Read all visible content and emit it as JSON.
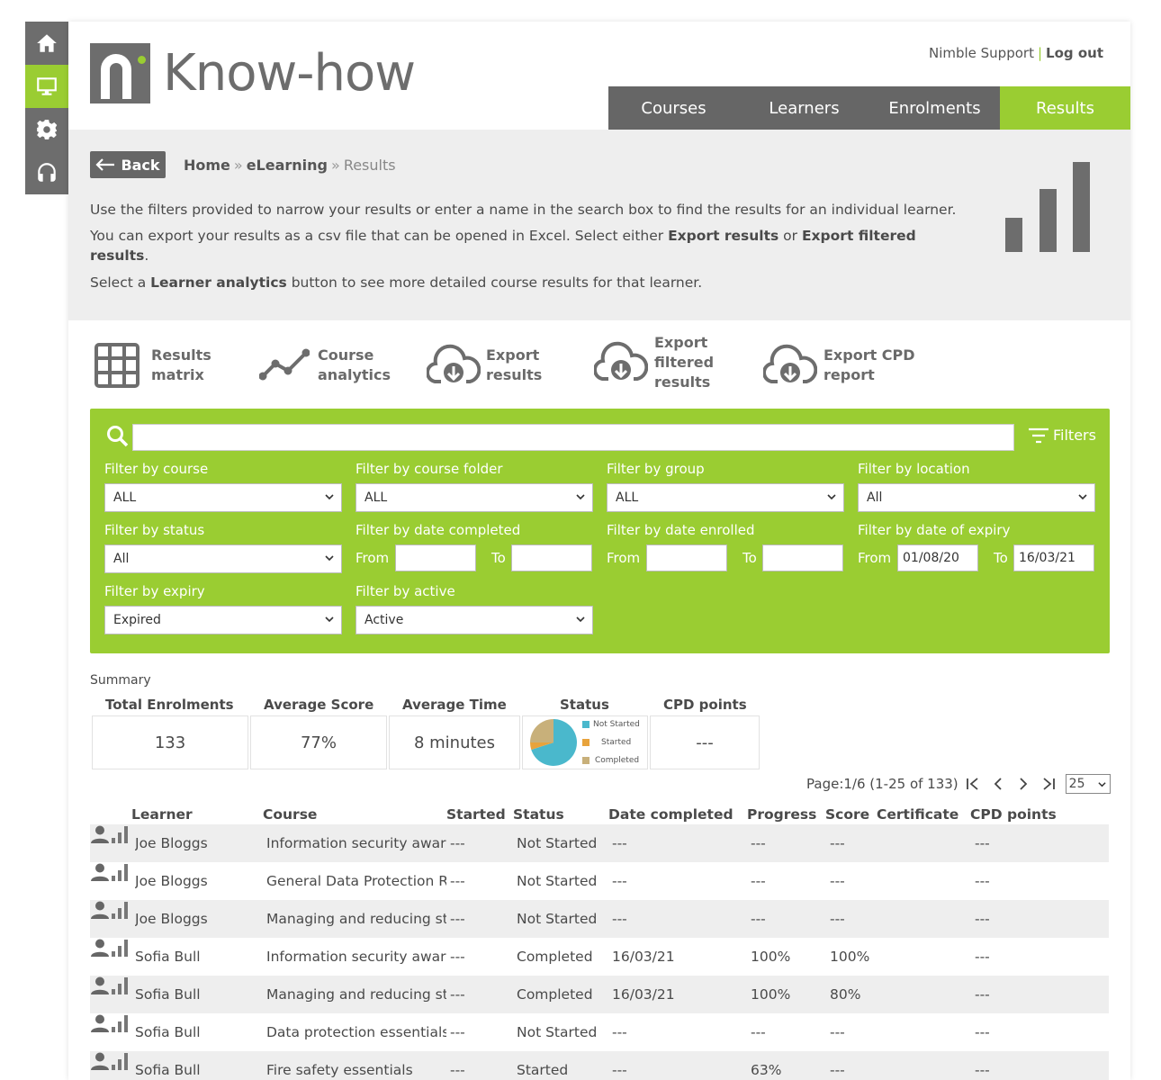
{
  "rail": {
    "items": [
      {
        "icon": "home-icon"
      },
      {
        "icon": "monitor-icon"
      },
      {
        "icon": "gear-icon"
      },
      {
        "icon": "headset-icon"
      }
    ]
  },
  "header": {
    "logo_text": "Know-how",
    "support_link": "Nimble Support",
    "separator": "|",
    "logout_link": "Log out"
  },
  "nav": {
    "tabs": [
      {
        "label": "Courses"
      },
      {
        "label": "Learners"
      },
      {
        "label": "Enrolments"
      },
      {
        "label": "Results"
      }
    ],
    "active": "Results"
  },
  "intro": {
    "back_label": "Back",
    "breadcrumb": [
      "Home",
      "eLearning",
      "Results"
    ],
    "breadcrumb_sep": "»",
    "line1": "Use the filters provided to narrow your results or enter a name in the search box to find the results for an individual learner.",
    "line2_a": "You can export your results as a csv file that can be opened in Excel. Select either ",
    "line2_b": "Export results",
    "line2_c": " or ",
    "line2_d": "Export filtered results",
    "line2_e": ".",
    "line3_a": "Select a ",
    "line3_b": "Learner analytics",
    "line3_c": " button to see more detailed course results for that learner."
  },
  "tools": [
    {
      "l1": "Results",
      "l2": "matrix"
    },
    {
      "l1": "Course",
      "l2": "analytics"
    },
    {
      "l1": "Export",
      "l2": "results"
    },
    {
      "l1": "Export",
      "l2": "filtered",
      "l3": "results"
    },
    {
      "l1": "Export CPD",
      "l2": "report"
    }
  ],
  "filters": {
    "search_value": "",
    "toggle_label": "Filters",
    "course": {
      "label": "Filter by course",
      "value": "ALL"
    },
    "folder": {
      "label": "Filter by course folder",
      "value": "ALL"
    },
    "group": {
      "label": "Filter by group",
      "value": "ALL"
    },
    "location": {
      "label": "Filter by location",
      "value": "All"
    },
    "status": {
      "label": "Filter by status",
      "value": "All"
    },
    "completed": {
      "label": "Filter by date completed",
      "from_label": "From",
      "to_label": "To",
      "from": "",
      "to": ""
    },
    "enrolled": {
      "label": "Filter by date enrolled",
      "from_label": "From",
      "to_label": "To",
      "from": "",
      "to": ""
    },
    "expiry_date": {
      "label": "Filter by date of expiry",
      "from_label": "From",
      "to_label": "To",
      "from": "01/08/20",
      "to": "16/03/21"
    },
    "expiry": {
      "label": "Filter by expiry",
      "value": "Expired"
    },
    "active": {
      "label": "Filter by active",
      "value": "Active"
    }
  },
  "summary": {
    "title": "Summary",
    "total_label": "Total Enrolments",
    "total": "133",
    "score_label": "Average Score",
    "score": "77%",
    "time_label": "Average Time",
    "time": "8 minutes",
    "status_label": "Status",
    "cpd_label": "CPD points",
    "cpd": "---",
    "pie": [
      {
        "name": "Not Started",
        "value": 0.7,
        "color": "#4ab8cc"
      },
      {
        "name": "Started",
        "value": 0.05,
        "color": "#e8a33c"
      },
      {
        "name": "Completed",
        "value": 0.25,
        "color": "#c8b07a"
      }
    ]
  },
  "pager": {
    "text": "Page:1/6 (1-25 of 133)",
    "page_size": "25"
  },
  "table": {
    "headers": [
      "Learner",
      "Course",
      "Started",
      "Status",
      "Date completed",
      "Progress",
      "Score",
      "Certificate",
      "CPD points"
    ],
    "rows": [
      {
        "learner": "Joe Bloggs",
        "course": "Information security awareness",
        "started": "---",
        "status": "Not Started",
        "date": "---",
        "progress": "---",
        "score": "---",
        "cpd": "---"
      },
      {
        "learner": "Joe Bloggs",
        "course": "General Data Protection Regulation",
        "started": "---",
        "status": "Not Started",
        "date": "---",
        "progress": "---",
        "score": "---",
        "cpd": "---"
      },
      {
        "learner": "Joe Bloggs",
        "course": "Managing and reducing stress",
        "started": "---",
        "status": "Not Started",
        "date": "---",
        "progress": "---",
        "score": "---",
        "cpd": "---"
      },
      {
        "learner": "Sofia Bull",
        "course": "Information security awareness",
        "started": "---",
        "status": "Completed",
        "date": "16/03/21",
        "progress": "100%",
        "score": "100%",
        "cpd": "---"
      },
      {
        "learner": "Sofia Bull",
        "course": "Managing and reducing stress",
        "started": "---",
        "status": "Completed",
        "date": "16/03/21",
        "progress": "100%",
        "score": "80%",
        "cpd": "---"
      },
      {
        "learner": "Sofia Bull",
        "course": "Data protection essentials",
        "started": "---",
        "status": "Not Started",
        "date": "---",
        "progress": "---",
        "score": "---",
        "cpd": "---"
      },
      {
        "learner": "Sofia Bull",
        "course": "Fire safety essentials",
        "started": "---",
        "status": "Started",
        "date": "---",
        "progress": "63%",
        "score": "---",
        "cpd": "---"
      }
    ]
  },
  "colors": {
    "brand_green": "#9acd32",
    "nav_grey": "#666666"
  }
}
